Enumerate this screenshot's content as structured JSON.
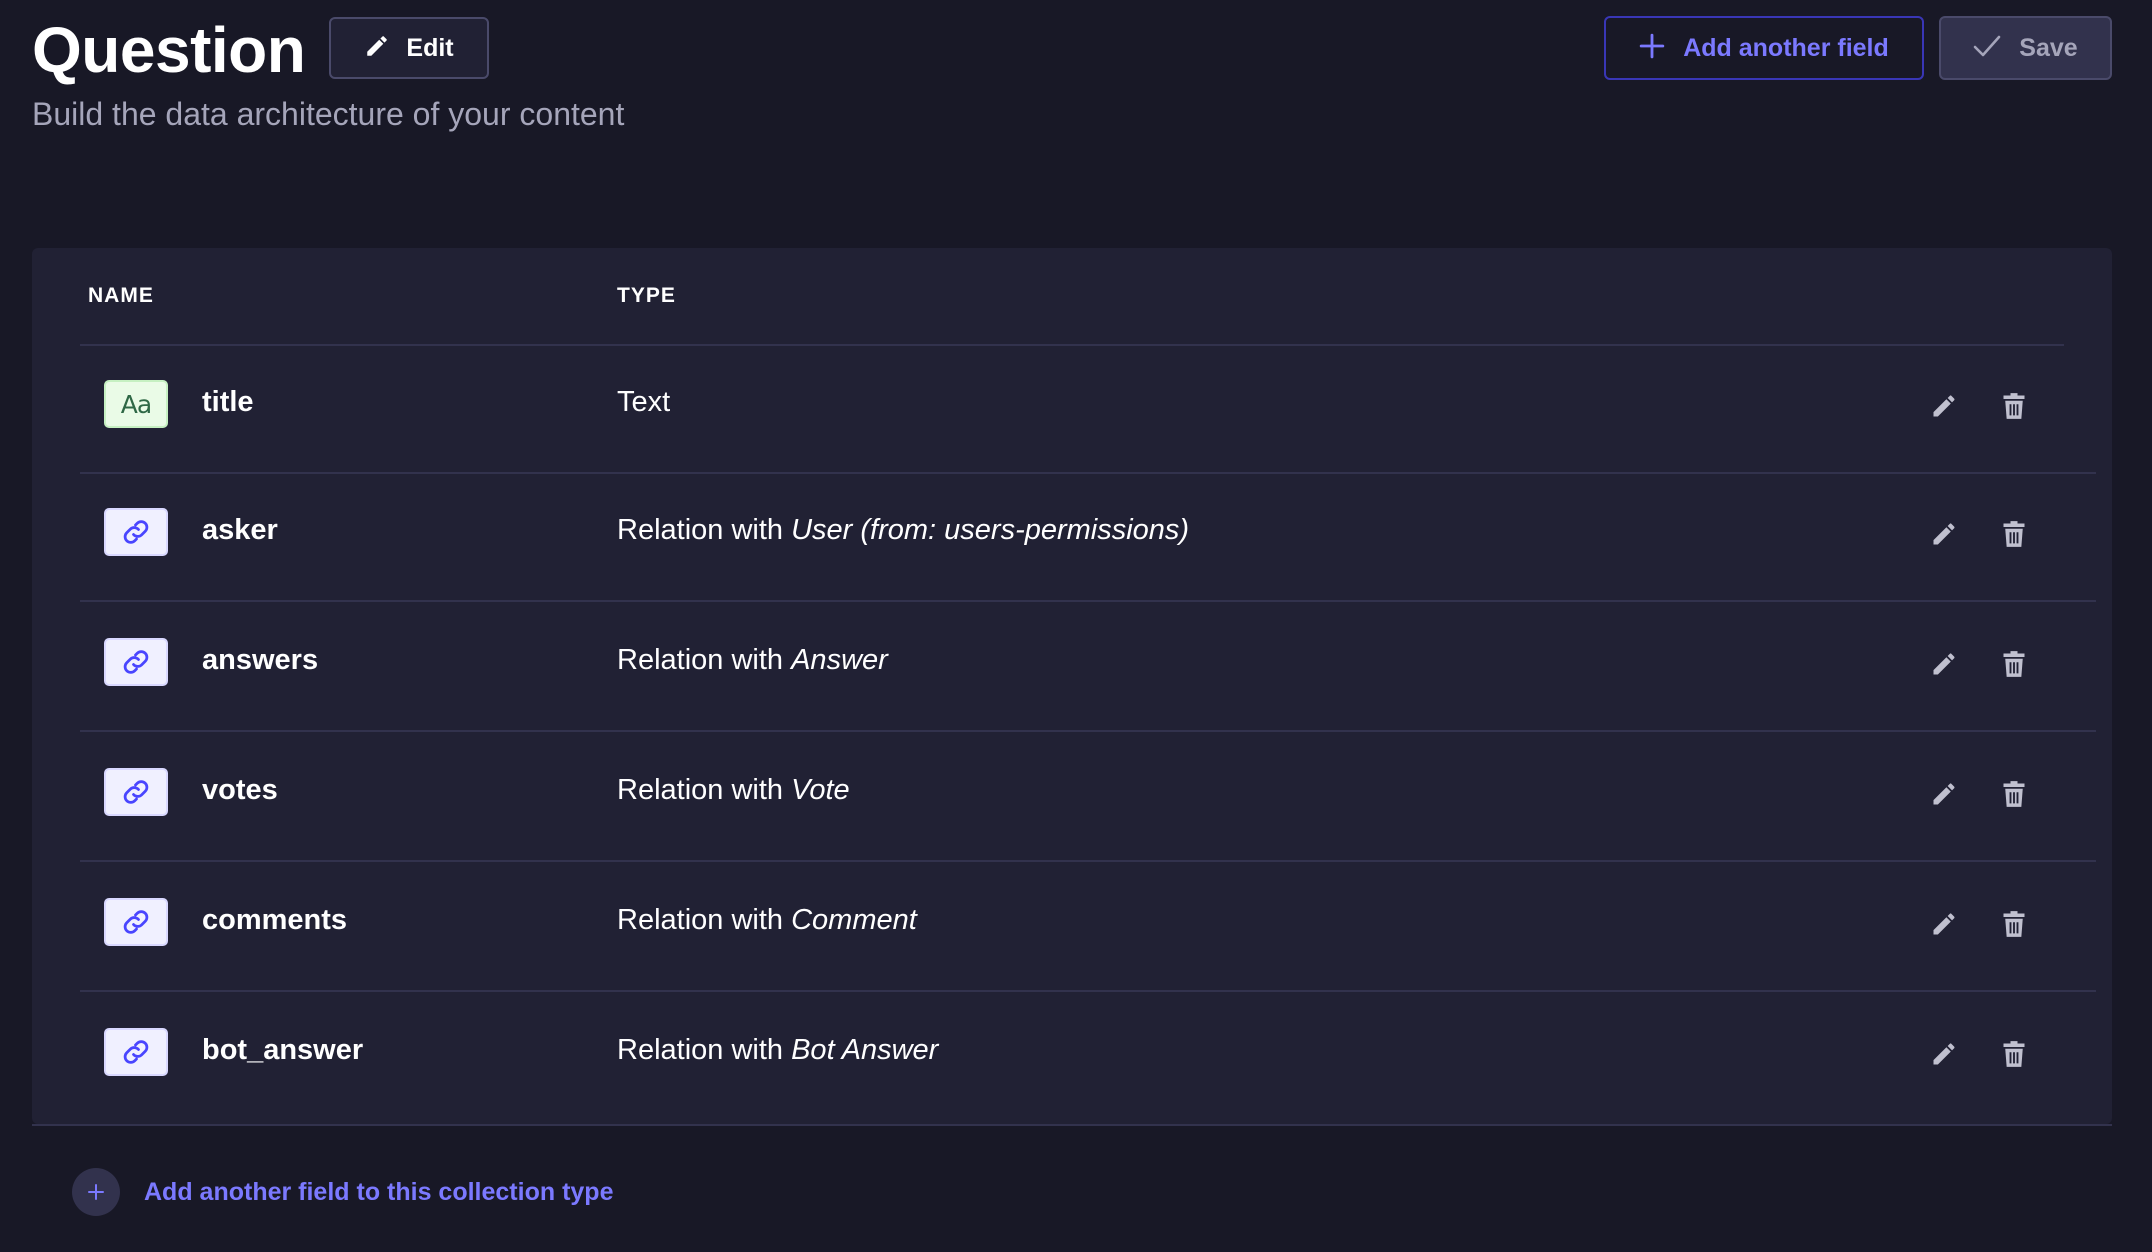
{
  "header": {
    "title": "Question",
    "subtitle": "Build the data architecture of your content",
    "edit_label": "Edit",
    "add_field_label": "Add another field",
    "save_label": "Save"
  },
  "table": {
    "columns": [
      "NAME",
      "TYPE"
    ],
    "rows": [
      {
        "icon": "text-icon",
        "badge": "Aa",
        "name": "title",
        "type_prefix": "Text",
        "type_target": ""
      },
      {
        "icon": "link-icon",
        "badge": "",
        "name": "asker",
        "type_prefix": "Relation with ",
        "type_target": "User (from: users-permissions)"
      },
      {
        "icon": "link-icon",
        "badge": "",
        "name": "answers",
        "type_prefix": "Relation with ",
        "type_target": "Answer"
      },
      {
        "icon": "link-icon",
        "badge": "",
        "name": "votes",
        "type_prefix": "Relation with ",
        "type_target": "Vote"
      },
      {
        "icon": "link-icon",
        "badge": "",
        "name": "comments",
        "type_prefix": "Relation with ",
        "type_target": "Comment"
      },
      {
        "icon": "link-icon",
        "badge": "",
        "name": "bot_answer",
        "type_prefix": "Relation with ",
        "type_target": "Bot Answer"
      }
    ]
  },
  "footer": {
    "add_field_label": "Add another field to this collection type"
  },
  "colors": {
    "background": "#181826",
    "surface": "#212134",
    "accent": "#7b79ff",
    "border": "#32324d"
  }
}
